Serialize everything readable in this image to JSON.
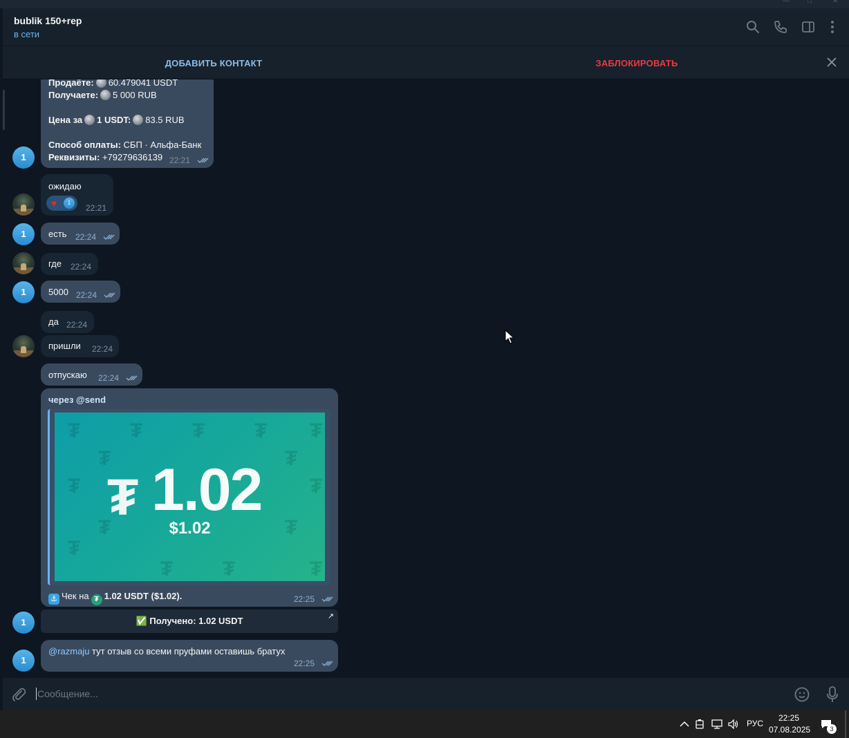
{
  "header": {
    "chat_name": "bublik 150+rep",
    "status": "в сети"
  },
  "action_bar": {
    "add_contact": "ДОБАВИТЬ КОНТАКТ",
    "block": "ЗАБЛОКИРОВАТЬ"
  },
  "messages": {
    "order": {
      "sell_label": "Продаёте:",
      "sell_value": "60.479041 USDT",
      "get_label": "Получаете:",
      "get_value": "5 000 RUB",
      "price_label": "Цена за",
      "price_unit": "1 USDT:",
      "price_value": "83.5 RUB",
      "method_label": "Способ оплаты:",
      "method_value": "СБП · Альфа-Банк",
      "details_label": "Реквизиты:",
      "details_value": "+79279636139",
      "time": "22:21"
    },
    "m_waiting": {
      "text": "ожидаю",
      "time": "22:21",
      "reaction_count": "1"
    },
    "m_est": {
      "text": "есть",
      "time": "22:24"
    },
    "m_gde": {
      "text": "где",
      "time": "22:24"
    },
    "m_5000": {
      "text": "5000",
      "time": "22:24"
    },
    "m_da": {
      "text": "да",
      "time": "22:24"
    },
    "m_prishli": {
      "text": "пришли",
      "time": "22:24"
    },
    "m_otpuskayu": {
      "text": "отпускаю",
      "time": "22:24"
    },
    "check": {
      "via": "через @send",
      "amount": "1.02",
      "usd": "$1.02",
      "caption_prefix": "Чек на",
      "caption_amount": "1.02 USDT ($1.02).",
      "time": "22:25"
    },
    "received_button": "✅ Получено: 1.02 USDT",
    "m_review": {
      "mention": "@razmaju",
      "text": " тут отзыв со всеми пруфами оставишь братух",
      "time": "22:25"
    },
    "sender_avatar_label": "1"
  },
  "composer": {
    "placeholder": "Сообщение..."
  },
  "taskbar": {
    "language": "РУС",
    "time": "22:25",
    "date": "07.08.2025",
    "notification_count": "3"
  },
  "colors": {
    "accent": "#6ab3f3",
    "block_red": "#ec3942",
    "outgoing_bubble": "#2b5278",
    "incoming_bubble": "#182533"
  }
}
